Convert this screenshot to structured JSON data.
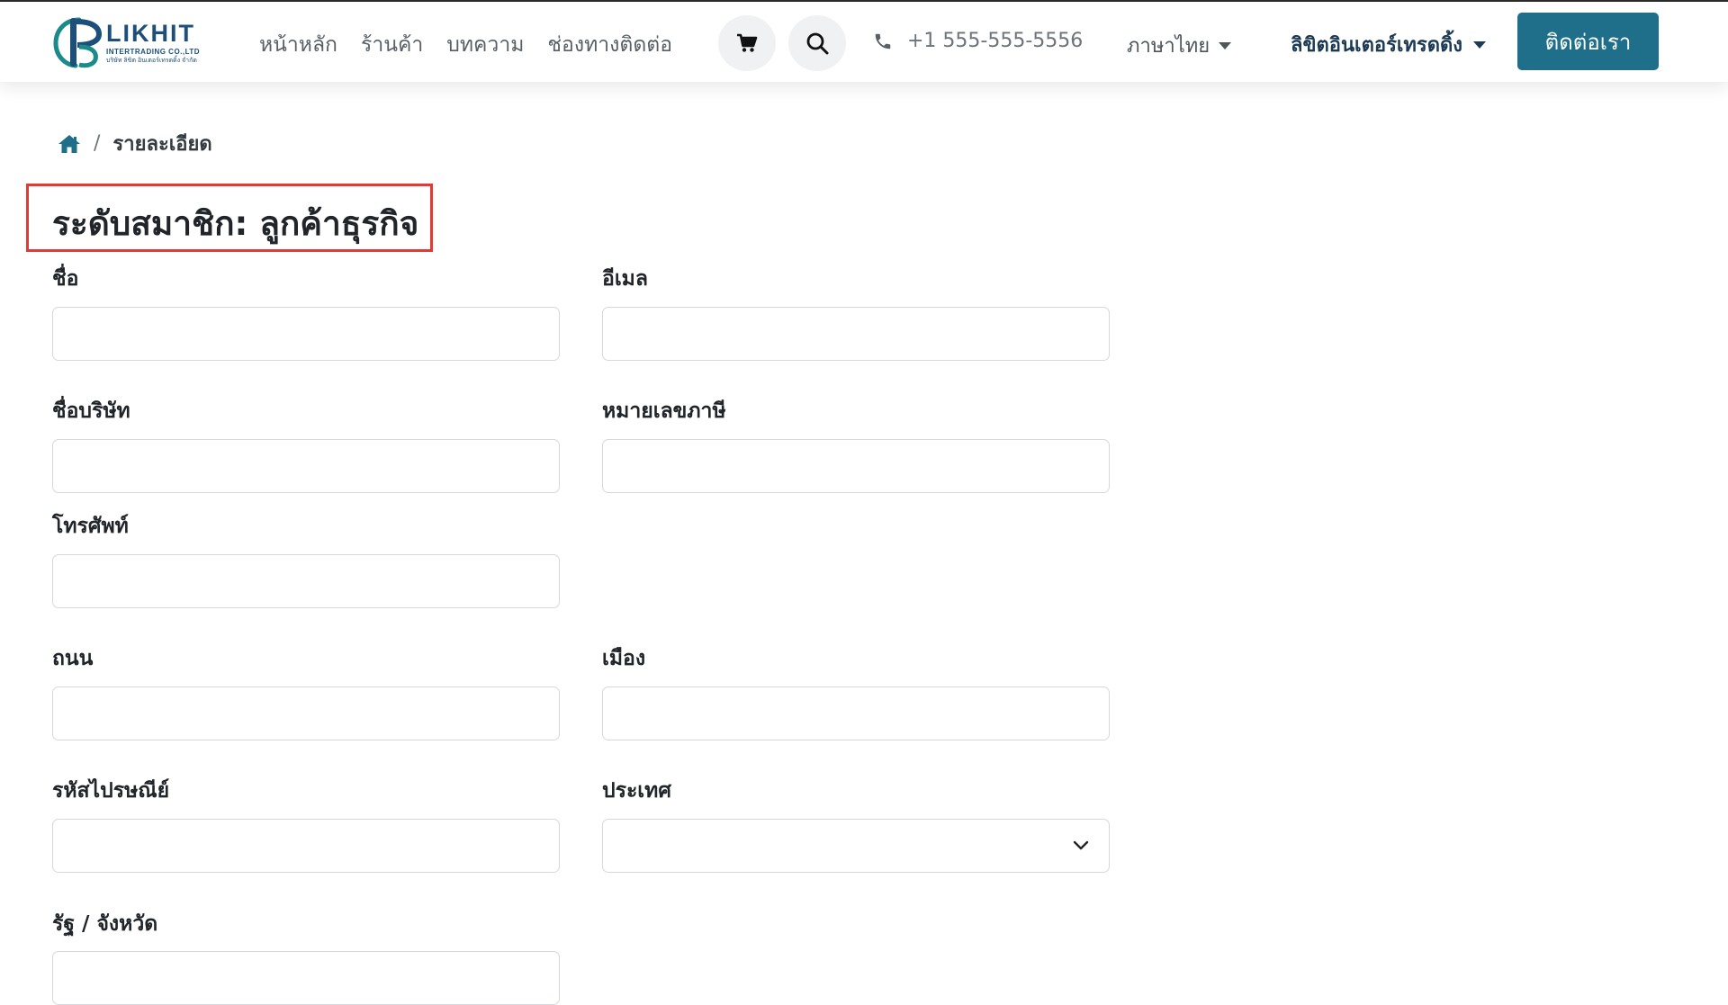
{
  "brand": {
    "name": "LIKHIT",
    "sub": "INTERTRADING CO.,LTD",
    "thai": "บริษัท ลิขิต อินเตอร์เทรดดิ้ง จำกัด",
    "primary_color": "#1f6f8b",
    "accent_color": "#e53935"
  },
  "nav": {
    "items": [
      {
        "label": "หน้าหลัก"
      },
      {
        "label": "ร้านค้า"
      },
      {
        "label": "บทความ"
      },
      {
        "label": "ช่องทางติดต่อ"
      }
    ],
    "cart_icon": "cart-icon",
    "search_icon": "search-icon",
    "phone_icon": "phone-icon",
    "phone": "+1 555-555-5556",
    "language": "ภาษาไทย",
    "company": "ลิขิตอินเตอร์เทรดดิ้ง",
    "contact_button": "ติดต่อเรา"
  },
  "breadcrumb": {
    "home_icon": "home-icon",
    "separator": "/",
    "current": "รายละเอียด"
  },
  "page": {
    "title": "ระดับสมาชิก: ลูกค้าธุรกิจ"
  },
  "form": {
    "name": {
      "label": "ชื่อ",
      "value": ""
    },
    "email": {
      "label": "อีเมล",
      "value": ""
    },
    "company": {
      "label": "ชื่อบริษัท",
      "value": ""
    },
    "tax_id": {
      "label": "หมายเลขภาษี",
      "value": ""
    },
    "phone": {
      "label": "โทรศัพท์",
      "value": ""
    },
    "street": {
      "label": "ถนน",
      "value": ""
    },
    "city": {
      "label": "เมือง",
      "value": ""
    },
    "zip": {
      "label": "รหัสไปรษณีย์",
      "value": ""
    },
    "country": {
      "label": "ประเทศ",
      "value": ""
    },
    "state": {
      "label": "รัฐ / จังหวัด",
      "value": ""
    }
  }
}
